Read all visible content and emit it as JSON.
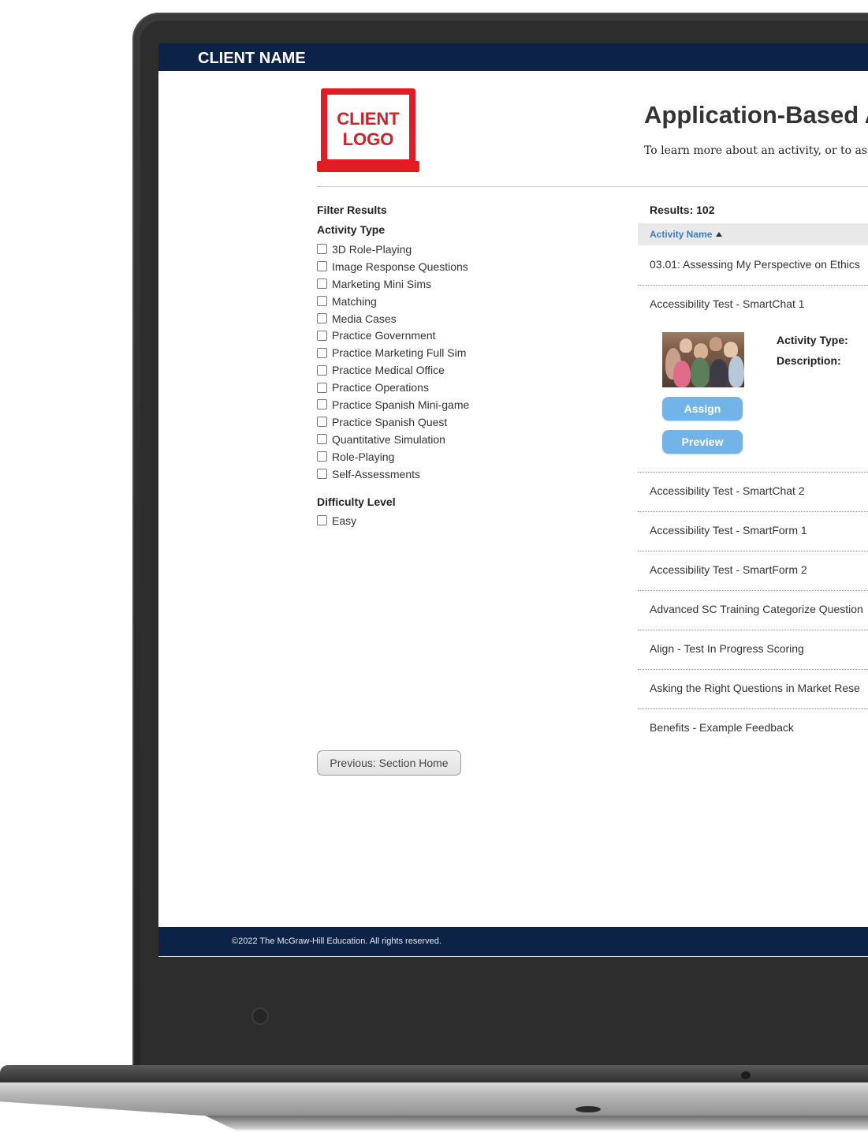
{
  "header": {
    "client_name": "CLIENT NAME"
  },
  "logo": {
    "line1": "CLIENT",
    "line2": "LOGO"
  },
  "page": {
    "title": "Application-Based A",
    "subtitle": "To learn more about an activity, or to assi"
  },
  "filters": {
    "title": "Filter Results",
    "activity_type": {
      "title": "Activity Type",
      "options": [
        "3D Role-Playing",
        "Image Response Questions",
        "Marketing Mini Sims",
        "Matching",
        "Media Cases",
        "Practice Government",
        "Practice Marketing Full Sim",
        "Practice Medical Office",
        "Practice Operations",
        "Practice Spanish Mini-game",
        "Practice Spanish Quest",
        "Quantitative Simulation",
        "Role-Playing",
        "Self-Assessments"
      ]
    },
    "difficulty": {
      "title": "Difficulty Level",
      "options": [
        "Easy"
      ]
    }
  },
  "navigation": {
    "previous_label": "Previous: Section Home"
  },
  "results": {
    "label": "Results: 102",
    "sort_column": "Activity Name",
    "items": [
      "03.01: Assessing My Perspective on Ethics",
      "Accessibility Test - SmartChat 1",
      "Accessibility Test - SmartChat 2",
      "Accessibility Test - SmartForm 1",
      "Accessibility Test - SmartForm 2",
      "Advanced SC Training Categorize Question",
      "Align - Test In Progress Scoring",
      "Asking the Right Questions in Market Rese",
      "Benefits - Example Feedback"
    ],
    "expanded": {
      "assign_label": "Assign",
      "preview_label": "Preview",
      "activity_type_label": "Activity Type:",
      "description_label": "Description:"
    }
  },
  "footer": {
    "copyright": "©2022 The McGraw-Hill Education. All rights reserved."
  },
  "colors": {
    "navy": "#0c2347",
    "logo_red": "#e31b23",
    "button_blue": "#73b4e8",
    "link_blue": "#3d7cc9"
  }
}
